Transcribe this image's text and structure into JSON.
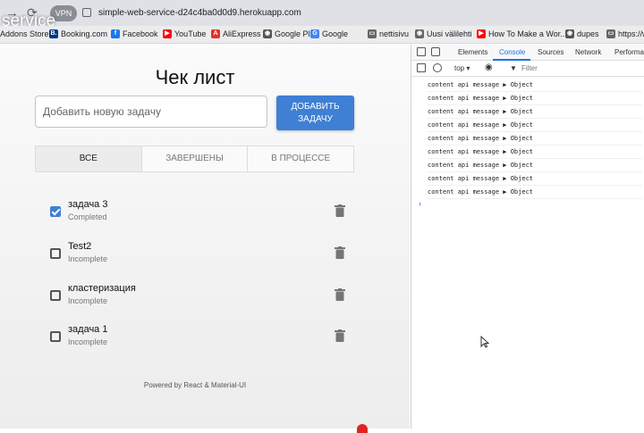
{
  "browser": {
    "overlay_title": "service",
    "vpn_label": "VPN",
    "url": "simple-web-service-d24c4ba0d0d9.herokuapp.com"
  },
  "bookmarks": [
    {
      "label": "Addons Store",
      "color": "#ececee"
    },
    {
      "label": "Booking.com",
      "color": "#003580",
      "glyph": "B."
    },
    {
      "label": "Facebook",
      "color": "#1877f2",
      "glyph": "f"
    },
    {
      "label": "YouTube",
      "color": "#ff0000",
      "glyph": "▶"
    },
    {
      "label": "AliExpress",
      "color": "#e43225",
      "glyph": "A"
    },
    {
      "label": "Google Play",
      "color": "#555555",
      "glyph": "◉"
    },
    {
      "label": "Google",
      "color": "#4285f4",
      "glyph": "G"
    },
    {
      "label": "nettisivu",
      "color": "#666666",
      "glyph": "▭"
    },
    {
      "label": "Uusi välilehti",
      "color": "#666666",
      "glyph": "◉"
    },
    {
      "label": "How To Make a Wor...",
      "color": "#ff0000",
      "glyph": "▶"
    },
    {
      "label": "dupes",
      "color": "#555555",
      "glyph": "◉"
    },
    {
      "label": "https://w...",
      "color": "#666666",
      "glyph": "▭"
    }
  ],
  "app": {
    "title": "Чек лист",
    "input_placeholder": "Добавить новую задачу",
    "add_button": "ДОБАВИТЬ ЗАДАЧУ",
    "tabs": [
      {
        "label": "ВСЕ",
        "active": true
      },
      {
        "label": "ЗАВЕРШЕНЫ",
        "active": false
      },
      {
        "label": "В ПРОЦЕССЕ",
        "active": false
      }
    ],
    "tasks": [
      {
        "name": "задача 3",
        "status": "Completed",
        "checked": true
      },
      {
        "name": "Test2",
        "status": "Incomplete",
        "checked": false
      },
      {
        "name": "кластеризация",
        "status": "Incomplete",
        "checked": false
      },
      {
        "name": "задача 1",
        "status": "Incomplete",
        "checked": false
      }
    ],
    "footer": "Powered by React & Material-UI",
    "accent_color": "#3f7fd4"
  },
  "devtools": {
    "tabs": [
      "Elements",
      "Console",
      "Sources",
      "Network",
      "Performan"
    ],
    "active_tab": "Console",
    "context": "top ▾",
    "filter_label": "Filter",
    "console_lines": [
      "content api message ▶ Object",
      "content api message ▶ Object",
      "content api message ▶ Object",
      "content api message ▶ Object",
      "content api message ▶ Object",
      "content api message ▶ Object",
      "content api message ▶ Object",
      "content api message ▶ Object",
      "content api message ▶ Object"
    ],
    "prompt_glyph": "›"
  }
}
